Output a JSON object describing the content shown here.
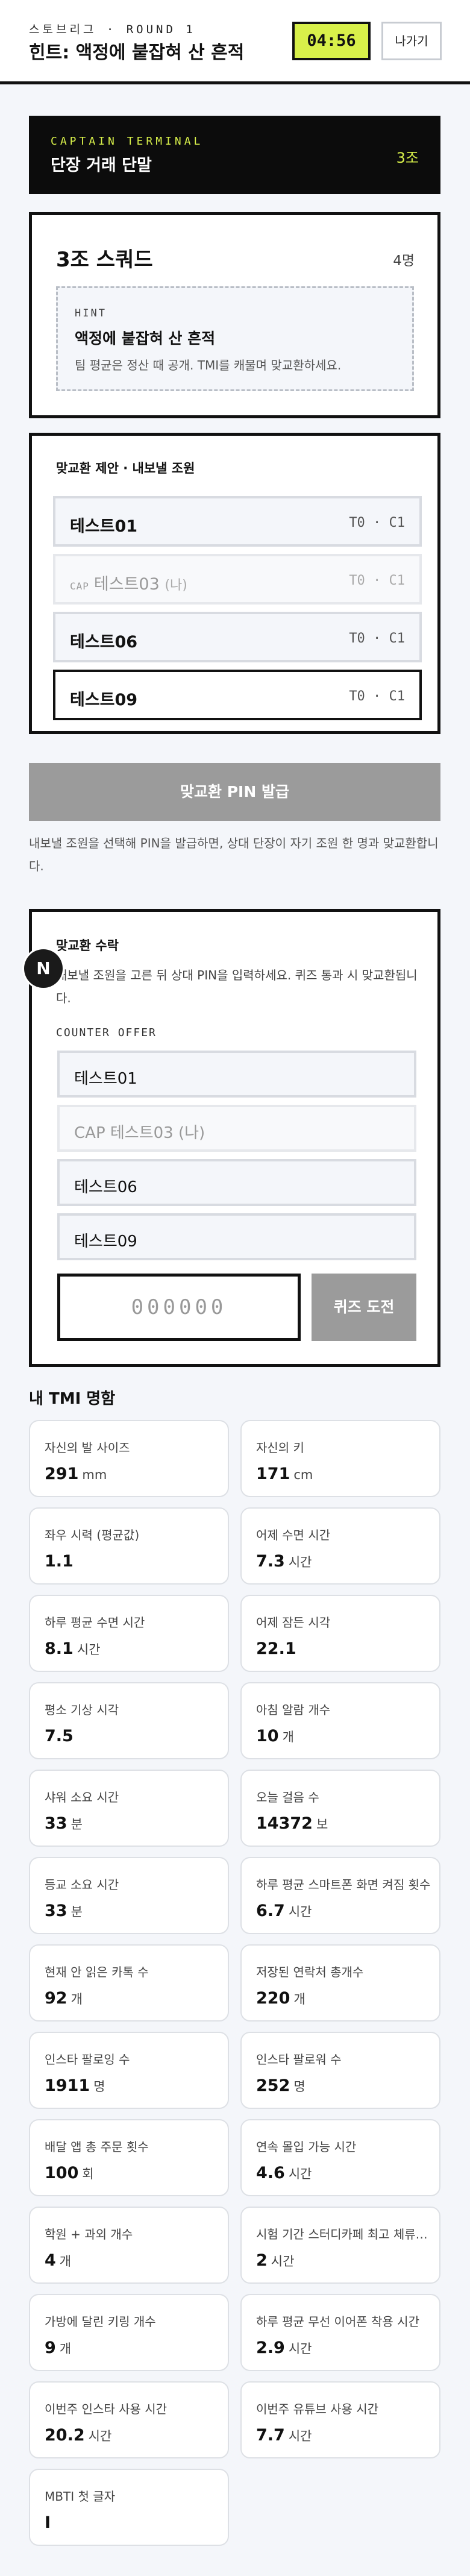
{
  "header": {
    "brand": "스토브리그 · ROUND 1",
    "hint_title": "힌트: 액정에 붙잡혀 산 흔적",
    "timer": "04:56",
    "leave_label": "나가기"
  },
  "terminal": {
    "eyebrow": "CAPTAIN TERMINAL",
    "title": "단장 거래 단말",
    "team": "3조"
  },
  "squad": {
    "name": "3조 스쿼드",
    "count": "4명",
    "hint": {
      "label": "HINT",
      "text": "액정에 붙잡혀 산 흔적",
      "desc": "팀 평균은 정산 때 공개. TMI를 캐물며 맞교환하세요."
    }
  },
  "proposal": {
    "title": "맞교환 제안 · 내보낼 조원",
    "members": [
      {
        "name": "테스트01",
        "meta": "T0 · C1",
        "cap": "",
        "suffix": ""
      },
      {
        "name": "테스트03",
        "meta": "T0 · C1",
        "cap": "CAP",
        "suffix": "(나)"
      },
      {
        "name": "테스트06",
        "meta": "T0 · C1",
        "cap": "",
        "suffix": ""
      },
      {
        "name": "테스트09",
        "meta": "T0 · C1",
        "cap": "",
        "suffix": ""
      }
    ],
    "pin_button": "맞교환 PIN 발급",
    "note": "내보낼 조원을 선택해 PIN을 발급하면, 상대 단장이 자기 조원 한 명과 맞교환합니다."
  },
  "accept": {
    "title": "맞교환 수락",
    "desc": "내보낼 조원을 고른 뒤 상대 PIN을 입력하세요. 퀴즈 통과 시 맞교환됩니다.",
    "counter_label": "COUNTER OFFER",
    "offers": [
      "테스트01",
      "CAP 테스트03 (나)",
      "테스트06",
      "테스트09"
    ],
    "pin_placeholder": "000000",
    "quiz_button": "퀴즈 도전"
  },
  "float_badge": "N",
  "tmi": {
    "title": "내 TMI 명함",
    "items": [
      {
        "q": "자신의 발 사이즈",
        "v": "291",
        "u": "mm"
      },
      {
        "q": "자신의 키",
        "v": "171",
        "u": "cm"
      },
      {
        "q": "좌우 시력 (평균값)",
        "v": "1.1",
        "u": ""
      },
      {
        "q": "어제 수면 시간",
        "v": "7.3",
        "u": "시간"
      },
      {
        "q": "하루 평균 수면 시간",
        "v": "8.1",
        "u": "시간"
      },
      {
        "q": "어제 잠든 시각",
        "v": "22.1",
        "u": ""
      },
      {
        "q": "평소 기상 시각",
        "v": "7.5",
        "u": ""
      },
      {
        "q": "아침 알람 개수",
        "v": "10",
        "u": "개"
      },
      {
        "q": "샤워 소요 시간",
        "v": "33",
        "u": "분"
      },
      {
        "q": "오늘 걸음 수",
        "v": "14372",
        "u": "보"
      },
      {
        "q": "등교 소요 시간",
        "v": "33",
        "u": "분"
      },
      {
        "q": "하루 평균 스마트폰 화면 켜짐 횟수",
        "v": "6.7",
        "u": "시간"
      },
      {
        "q": "현재 안 읽은 카톡 수",
        "v": "92",
        "u": "개"
      },
      {
        "q": "저장된 연락처 총개수",
        "v": "220",
        "u": "개"
      },
      {
        "q": "인스타 팔로잉 수",
        "v": "1911",
        "u": "명"
      },
      {
        "q": "인스타 팔로워 수",
        "v": "252",
        "u": "명"
      },
      {
        "q": "배달 앱 총 주문 횟수",
        "v": "100",
        "u": "회"
      },
      {
        "q": "연속 몰입 가능 시간",
        "v": "4.6",
        "u": "시간"
      },
      {
        "q": "학원 + 과외 개수",
        "v": "4",
        "u": "개"
      },
      {
        "q": "시험 기간 스터디카페 최고 체류 시간",
        "v": "2",
        "u": "시간"
      },
      {
        "q": "가방에 달린 키링 개수",
        "v": "9",
        "u": "개"
      },
      {
        "q": "하루 평균 무선 이어폰 착용 시간",
        "v": "2.9",
        "u": "시간"
      },
      {
        "q": "이번주 인스타 사용 시간",
        "v": "20.2",
        "u": "시간"
      },
      {
        "q": "이번주 유튜브 사용 시간",
        "v": "7.7",
        "u": "시간"
      },
      {
        "q": "MBTI 첫 글자",
        "v": "I",
        "u": ""
      }
    ]
  }
}
